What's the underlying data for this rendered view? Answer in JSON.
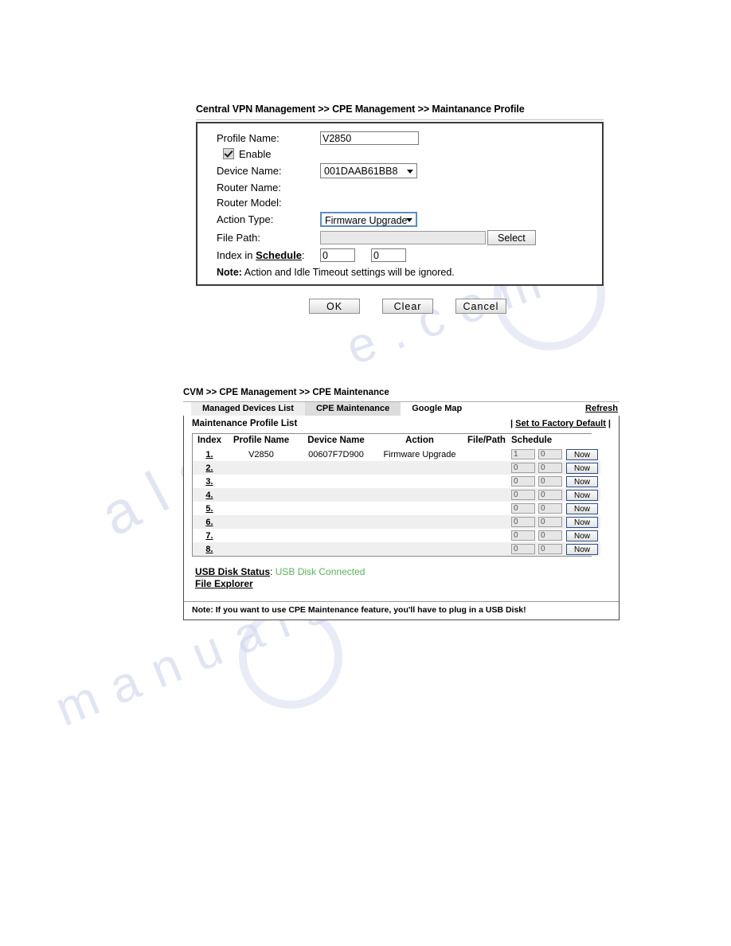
{
  "watermark": {
    "a": "e . c o m",
    "b": "a l s h",
    "c": "m a n u a l s"
  },
  "section_one": {
    "breadcrumb": "Central VPN Management >> CPE Management >> Maintanance Profile",
    "fields": {
      "profile_name_label": "Profile Name:",
      "profile_name_value": "V2850",
      "enable_label": "Enable",
      "device_name_label": "Device Name:",
      "device_name_value": "001DAAB61BB8",
      "router_name_label": "Router Name:",
      "router_name_value": "",
      "router_model_label": "Router Model:",
      "router_model_value": "",
      "action_type_label": "Action Type:",
      "action_type_value": "Firmware Upgrade",
      "file_path_label": "File Path:",
      "file_path_value": "",
      "select_button": "Select",
      "index_schedule_label_pre": "Index in ",
      "index_schedule_label_link": "Schedule",
      "index_schedule_label_post": ":",
      "schedule_1": "0",
      "schedule_2": "0",
      "note_bold": "Note:",
      "note_text": " Action and Idle Timeout settings will be ignored."
    },
    "buttons": {
      "ok": "OK",
      "clear": "Clear",
      "cancel": "Cancel"
    }
  },
  "section_two": {
    "breadcrumb": "CVM >> CPE Management >> CPE Maintenance",
    "tabs": [
      {
        "label": "Managed Devices List",
        "state": "inactive"
      },
      {
        "label": "CPE Maintenance",
        "state": "active"
      },
      {
        "label": "Google Map",
        "state": "plain"
      }
    ],
    "refresh_label": "Refresh",
    "list_title": "Maintenance Profile List",
    "factory_default": "Set to Factory Default",
    "factory_default_bars": "|",
    "columns": [
      "Index",
      "Profile Name",
      "Device Name",
      "Action",
      "File/Path",
      "Schedule"
    ],
    "rows": [
      {
        "index": "1.",
        "profile_name": "V2850",
        "device_name": "00607F7D900",
        "action": "Firmware Upgrade",
        "file_path": "",
        "sched_a": "1",
        "sched_b": "0",
        "now": "Now"
      },
      {
        "index": "2.",
        "profile_name": "",
        "device_name": "",
        "action": "",
        "file_path": "",
        "sched_a": "0",
        "sched_b": "0",
        "now": "Now"
      },
      {
        "index": "3.",
        "profile_name": "",
        "device_name": "",
        "action": "",
        "file_path": "",
        "sched_a": "0",
        "sched_b": "0",
        "now": "Now"
      },
      {
        "index": "4.",
        "profile_name": "",
        "device_name": "",
        "action": "",
        "file_path": "",
        "sched_a": "0",
        "sched_b": "0",
        "now": "Now"
      },
      {
        "index": "5.",
        "profile_name": "",
        "device_name": "",
        "action": "",
        "file_path": "",
        "sched_a": "0",
        "sched_b": "0",
        "now": "Now"
      },
      {
        "index": "6.",
        "profile_name": "",
        "device_name": "",
        "action": "",
        "file_path": "",
        "sched_a": "0",
        "sched_b": "0",
        "now": "Now"
      },
      {
        "index": "7.",
        "profile_name": "",
        "device_name": "",
        "action": "",
        "file_path": "",
        "sched_a": "0",
        "sched_b": "0",
        "now": "Now"
      },
      {
        "index": "8.",
        "profile_name": "",
        "device_name": "",
        "action": "",
        "file_path": "",
        "sched_a": "0",
        "sched_b": "0",
        "now": "Now"
      }
    ],
    "usb_status_label": "USB Disk Status",
    "usb_status_sep": ": ",
    "usb_status_value": "USB Disk Connected",
    "file_explorer": "File Explorer",
    "note": "Note: If you want to use CPE Maintenance feature, you'll have to plug in a USB Disk!"
  },
  "colors": {
    "usb_green": "#5bb05b",
    "panel_border": "#3a3a3a",
    "tab_active": "#dcdcdc",
    "tab_inactive": "#ededed",
    "row_even": "#efefef"
  }
}
